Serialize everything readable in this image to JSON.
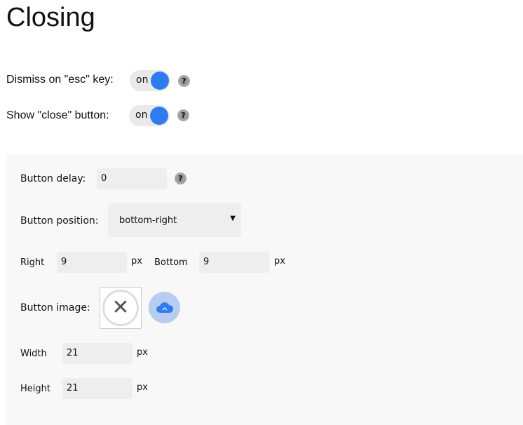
{
  "title": "Closing",
  "dismiss_esc": {
    "label": "Dismiss on \"esc\" key:",
    "state": "on",
    "help": "?"
  },
  "show_close": {
    "label": "Show \"close\" button:",
    "state": "on",
    "help": "?"
  },
  "button_delay": {
    "label": "Button delay:",
    "value": "0",
    "help": "?"
  },
  "button_position": {
    "label": "Button position:",
    "value": "bottom-right"
  },
  "right": {
    "label": "Right",
    "value": "9",
    "unit": "px"
  },
  "bottom": {
    "label": "Bottom",
    "value": "9",
    "unit": "px"
  },
  "button_image": {
    "label": "Button image:"
  },
  "width": {
    "label": "Width",
    "value": "21",
    "unit": "px"
  },
  "height": {
    "label": "Height",
    "value": "21",
    "unit": "px"
  },
  "colors": {
    "accent": "#2f7cf0"
  }
}
